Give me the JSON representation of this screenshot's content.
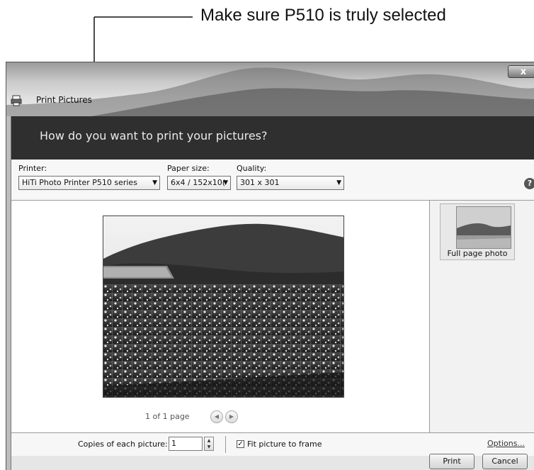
{
  "annotation": {
    "text": "Make sure P510 is truly selected"
  },
  "window": {
    "title": "Print Pictures",
    "close_label": "x"
  },
  "header": {
    "question": "How do you want to print your pictures?"
  },
  "options": {
    "printer_label": "Printer:",
    "printer_value": "HiTi Photo Printer P510 series",
    "paper_label": "Paper size:",
    "paper_value": "6x4 / 152x10(",
    "quality_label": "Quality:",
    "quality_value": "301 x 301",
    "help_label": "?"
  },
  "preview": {
    "page_info": "1 of 1 page",
    "prev_icon": "left-arrow-icon",
    "next_icon": "right-arrow-icon"
  },
  "layouts": {
    "items": [
      {
        "label": "Full page photo"
      }
    ]
  },
  "bottom": {
    "copies_label": "Copies of each picture:",
    "copies_value": "1",
    "fit_checked": true,
    "fit_label": "Fit picture to frame",
    "options_link": "Options..."
  },
  "actions": {
    "print_label": "Print",
    "cancel_label": "Cancel"
  }
}
